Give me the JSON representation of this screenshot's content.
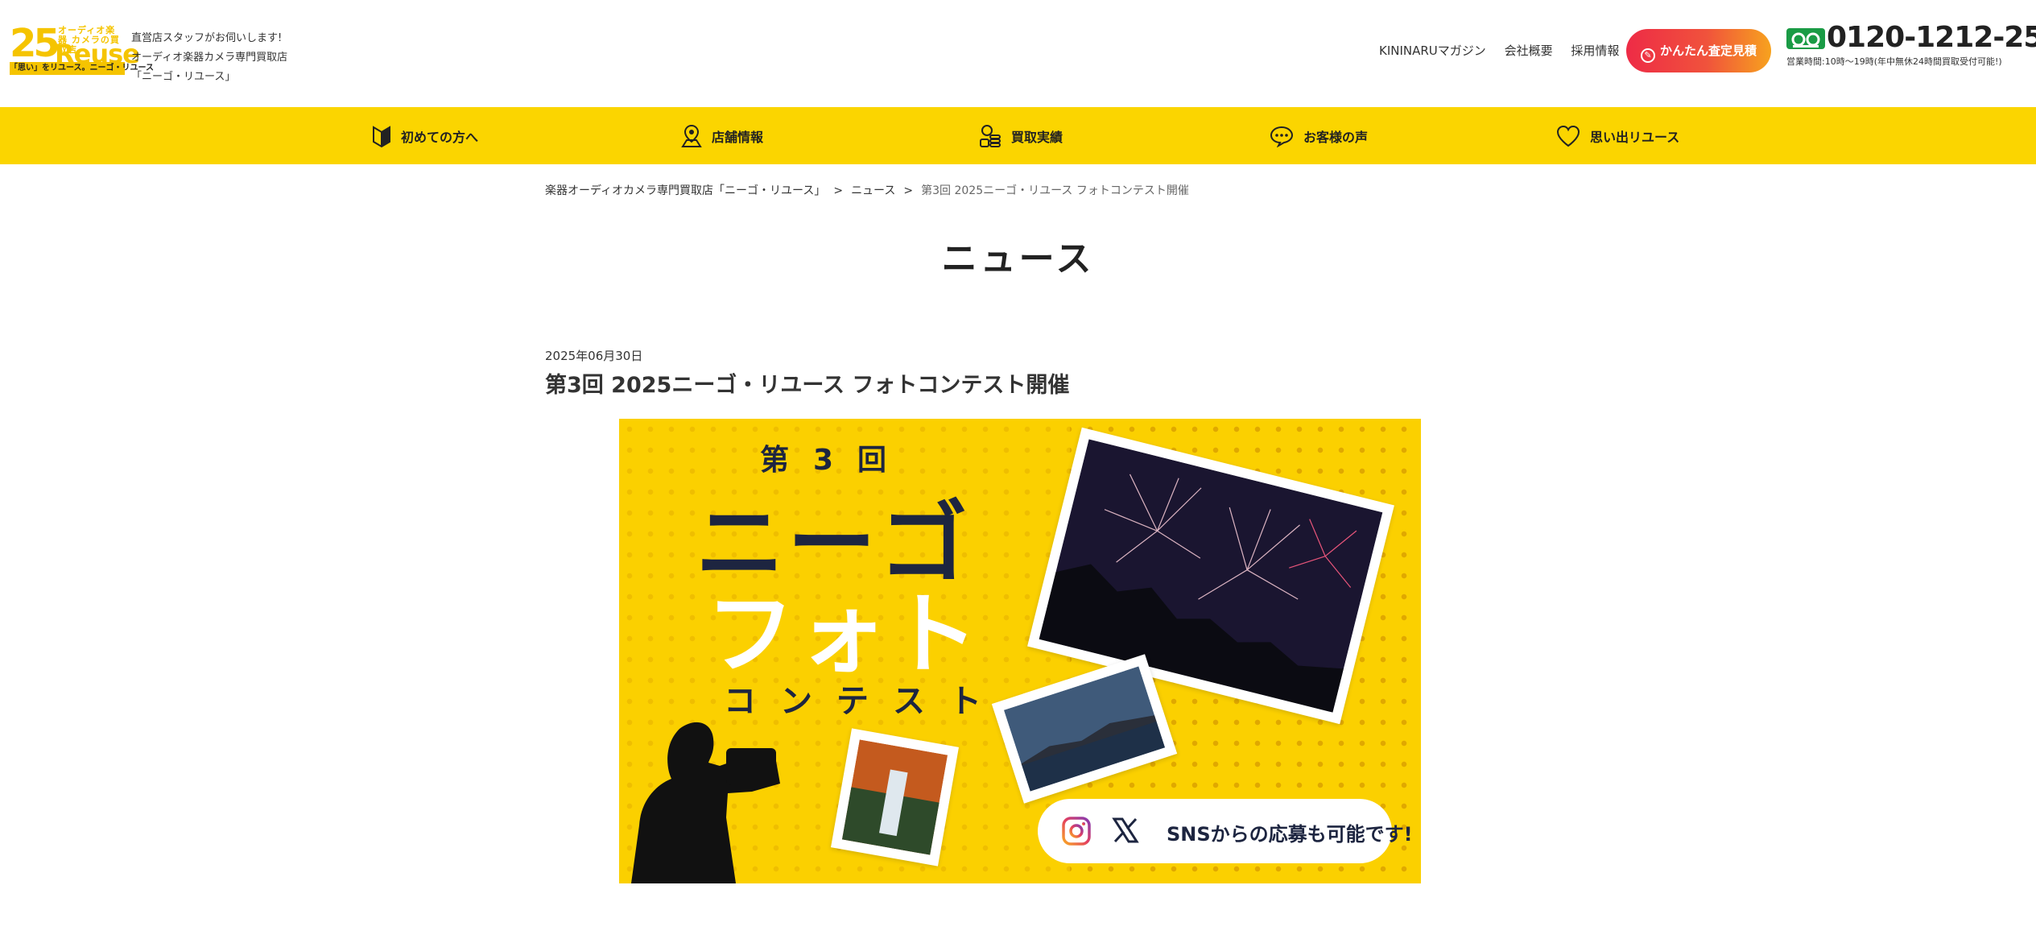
{
  "header": {
    "logo": {
      "number": "25",
      "small_text": "オーディオ楽器 カメラの買取店",
      "reuse": "Reuse",
      "strip": "「思い」をリユース。ニーゴ・リユース"
    },
    "tagline": [
      "直営店スタッフがお伺いします!",
      "オーディオ楽器カメラ専門買取店",
      "「ニーゴ・リユース」"
    ],
    "links": [
      "KININARUマガジン",
      "会社概要",
      "採用情報"
    ],
    "cta_label": "かんたん査定見積",
    "phone": "0120-1212-25",
    "hours": "営業時間:10時〜19時(年中無休24時間買取受付可能!)"
  },
  "nav": [
    {
      "label": "初めての方へ",
      "icon": "beginner-mark-icon"
    },
    {
      "label": "店舗情報",
      "icon": "map-pin-icon"
    },
    {
      "label": "買取実績",
      "icon": "coins-icon"
    },
    {
      "label": "お客様の声",
      "icon": "speech-bubble-icon"
    },
    {
      "label": "思い出リユース",
      "icon": "heart-icon"
    }
  ],
  "breadcrumb": {
    "home": "楽器オーディオカメラ専門買取店「ニーゴ・リユース」",
    "section": "ニュース",
    "current": "第3回 2025ニーゴ・リユース フォトコンテスト開催",
    "separator": ">"
  },
  "page_title": "ニュース",
  "post": {
    "date": "2025年06月30日",
    "title": "第3回 2025ニーゴ・リユース フォトコンテスト開催"
  },
  "banner": {
    "line_num": "第3回",
    "line1": "ニーゴ",
    "line2": "フォト",
    "line3": "コンテスト",
    "sns_text": "SNSからの応募も可能です!"
  },
  "colors": {
    "brand_yellow": "#fbd500",
    "cta_start": "#ee2b46",
    "cta_end": "#f7a21e",
    "freedial_green": "#1a9b45",
    "text_dark": "#222222"
  }
}
